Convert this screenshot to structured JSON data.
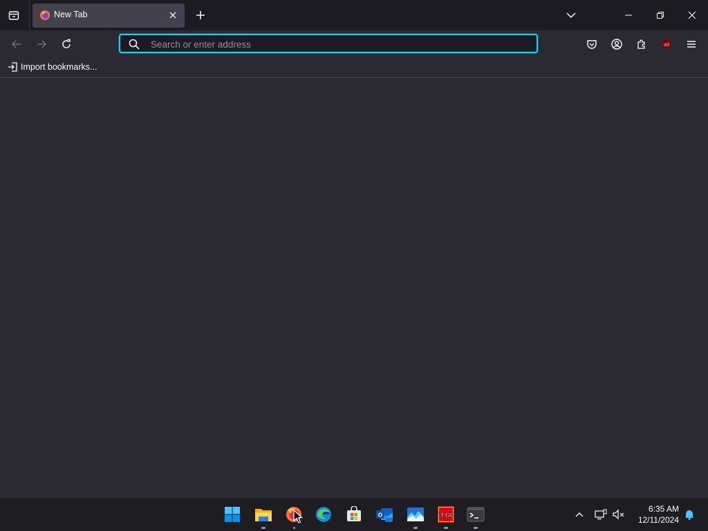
{
  "browser": {
    "tabs": [
      {
        "title": "New Tab"
      }
    ],
    "urlbar": {
      "placeholder": "Search or enter address",
      "value": ""
    },
    "bookmarks_toolbar": {
      "import_label": "Import bookmarks..."
    },
    "accent_color": "#00ddff",
    "toolbar_icons": [
      "pocket-icon",
      "account-icon",
      "extensions-icon",
      "ublock-origin-icon",
      "menu-icon"
    ]
  },
  "taskbar": {
    "apps": [
      {
        "name": "start-button",
        "icon": "windows-logo-icon",
        "running": false
      },
      {
        "name": "file-explorer",
        "icon": "folder-icon",
        "running": true
      },
      {
        "name": "firefox",
        "icon": "firefox-icon",
        "running": true
      },
      {
        "name": "edge",
        "icon": "edge-icon",
        "running": false
      },
      {
        "name": "microsoft-store",
        "icon": "store-icon",
        "running": false
      },
      {
        "name": "outlook-new",
        "icon": "outlook-icon",
        "running": false
      },
      {
        "name": "photos",
        "icon": "photos-icon",
        "running": true
      },
      {
        "name": "lego",
        "icon": "lego-icon",
        "running": true
      },
      {
        "name": "terminal",
        "icon": "terminal-icon",
        "running": true
      }
    ],
    "clock": {
      "time": "6:35 AM",
      "date": "12/11/2024"
    }
  }
}
